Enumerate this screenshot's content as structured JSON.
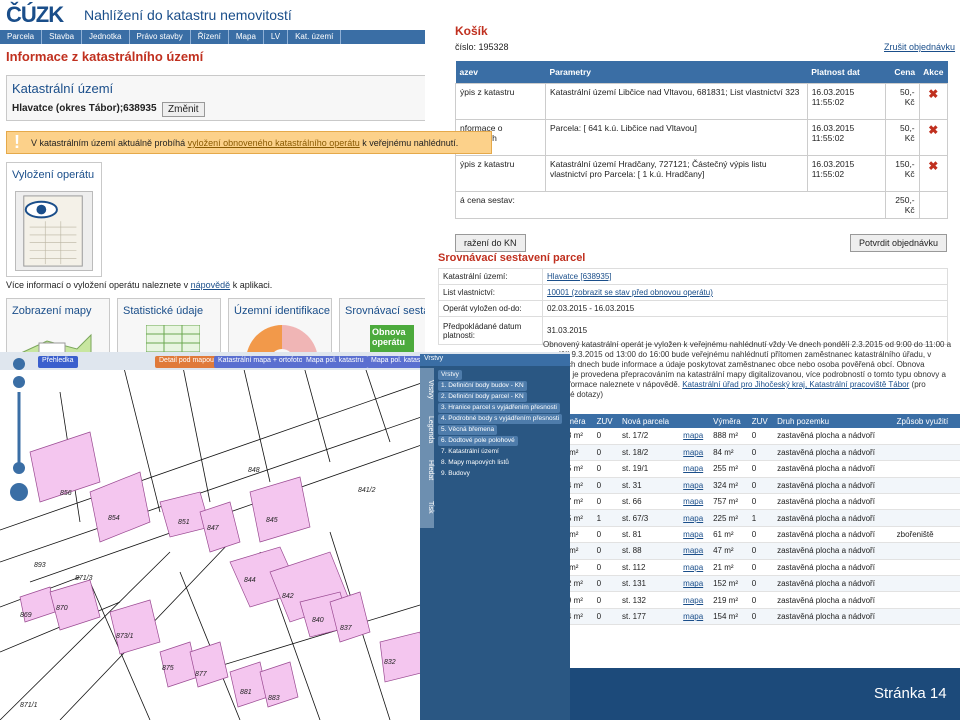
{
  "info_window": {
    "logo": "ČÚZK",
    "app_title": "Nahlížení do katastru nemovitostí",
    "menu": [
      "Parcela",
      "Stavba",
      "Jednotka",
      "Právo stavby",
      "Řízení",
      "Mapa",
      "LV",
      "Kat. území"
    ],
    "heading": "Informace z katastrálního území",
    "box_title": "Katastrální území",
    "box_value": "Hlavatce (okres Tábor);638935",
    "change_button": "Změnit",
    "warning_prefix": "V katastrálním území aktuálně probíhá",
    "warning_link": "vyložení obnoveného katastrálního operátu",
    "warning_suffix": "k veřejnému nahlédnutí.",
    "vylozeni_title": "Vyložení operátu",
    "more_prefix": "Více informací o vyložení operátu naleznete v",
    "more_link": "nápovědě",
    "more_suffix": "k aplikaci.",
    "tiles": [
      "Zobrazení mapy",
      "Statistické údaje",
      "Územní identifikace",
      "Srovnávací sestaven"
    ],
    "tile_badge": "Obnova operátu"
  },
  "cart_window": {
    "title": "Košík",
    "order_no": "číslo: 195328",
    "cancel_link": "Zrušit objednávku",
    "columns": [
      "azev",
      "Parametry",
      "Platnost dat",
      "Cena",
      "Akce"
    ],
    "rows": [
      {
        "name": "ýpis z katastru",
        "params": "Katastrální území Libčice nad Vltavou, 681831; List vlastnictví 323",
        "validity": "16.03.2015 11:55:02",
        "price": "50,- Kč"
      },
      {
        "name": "nformace o parcelách",
        "params": "Parcela: [ 641 k.ú. Libčice nad Vltavou]",
        "validity": "16.03.2015 11:55:02",
        "price": "50,- Kč"
      },
      {
        "name": "ýpis z katastru",
        "params": "Katastrální území Hradčany, 727121; Částečný výpis listu vlastnictví pro Parcela: [ 1 k.ú. Hradčany]",
        "validity": "16.03.2015 11:55:02",
        "price": "150,- Kč"
      }
    ],
    "total_label": "á cena sestav:",
    "total_value": "250,- Kč",
    "back_button": "ražení do KN",
    "confirm_button": "Potvrdit objednávku",
    "section_title": "Srovnávací sestavení parcel",
    "info_rows": [
      {
        "k": "Katastrální území:",
        "v": "Hlavatce [638935]"
      },
      {
        "k": "List vlastnictví:",
        "v": "10001 (zobrazit se stav před obnovou operátu)"
      },
      {
        "k": "Operát vyložen od-do:",
        "v": "02.03.2015 - 16.03.2015"
      },
      {
        "k": "Předpokládané datum platnosti:",
        "v": "31.03.2015"
      }
    ],
    "note": "Obnovený katastrální operát je vyložen k veřejnému nahlédnutí vždy Ve dnech pondělí 2.3.2015 od 9:00 do 11:00 a pondělí 9.3.2015 od 13:00 do 16:00 bude veřejnému nahlédnutí přítomen zaměstnanec katastrálního úřadu, v ostatních dnech bude informace a údaje poskytovat zaměstnanec obce nebo osoba pověřená obcí. Obnova operátu je provedena přepracováním na katastrální mapy digitalizovanou, více podrobností o tomto typu obnovy a další informace naleznete v nápovědě.",
    "note_link": "Katastrální úřad pro Jihočeský kraj, Katastrální pracoviště Tábor",
    "note_link_suffix": "(pro případné dotazy)",
    "parcel_columns": [
      "Výměra",
      "ZUV",
      "Nová parcela",
      "Výměra",
      "ZUV",
      "Druh pozemku",
      "Způsob využití"
    ],
    "parcels": [
      [
        "888 m²",
        "0",
        "st. 17/2",
        "mapa",
        "888 m²",
        "0",
        "zastavěná plocha a nádvoří",
        ""
      ],
      [
        "84 m²",
        "0",
        "st. 18/2",
        "mapa",
        "84 m²",
        "0",
        "zastavěná plocha a nádvoří",
        ""
      ],
      [
        "255 m²",
        "0",
        "st. 19/1",
        "mapa",
        "255 m²",
        "0",
        "zastavěná plocha a nádvoří",
        ""
      ],
      [
        "324 m²",
        "0",
        "st. 31",
        "mapa",
        "324 m²",
        "0",
        "zastavěná plocha a nádvoří",
        ""
      ],
      [
        "757 m²",
        "0",
        "st. 66",
        "mapa",
        "757 m²",
        "0",
        "zastavěná plocha a nádvoří",
        ""
      ],
      [
        "225 m²",
        "1",
        "st. 67/3",
        "mapa",
        "225 m²",
        "1",
        "zastavěná plocha a nádvoří",
        ""
      ],
      [
        "61 m²",
        "0",
        "st. 81",
        "mapa",
        "61 m²",
        "0",
        "zastavěná plocha a nádvoří",
        "zbořeniště"
      ],
      [
        "47 m²",
        "0",
        "st. 88",
        "mapa",
        "47 m²",
        "0",
        "zastavěná plocha a nádvoří",
        ""
      ],
      [
        "21 m²",
        "0",
        "st. 112",
        "mapa",
        "21 m²",
        "0",
        "zastavěná plocha a nádvoří",
        ""
      ],
      [
        "152 m²",
        "0",
        "st. 131",
        "mapa",
        "152 m²",
        "0",
        "zastavěná plocha a nádvoří",
        ""
      ],
      [
        "219 m²",
        "0",
        "st. 132",
        "mapa",
        "219 m²",
        "0",
        "zastavěná plocha a nádvoří",
        ""
      ],
      [
        "154 m²",
        "0",
        "st. 177",
        "mapa",
        "154 m²",
        "0",
        "zastavěná plocha a nádvoří",
        ""
      ]
    ],
    "page_label": "Stránka 14"
  },
  "map_window": {
    "buttons": [
      "Přehledka",
      "Detail pod mapou",
      "Katastrální mapa + ortofoto",
      "Mapa pol. katastru",
      "Mapa pol. katastru +"
    ],
    "layers_title": "Vrstvy",
    "side_tabs": [
      "Vrstvy",
      "Legenda",
      "Hledat",
      "Tisk"
    ],
    "layers": [
      "Vrstvy",
      "1. Definiční body budov - KN",
      "2. Definiční body parcel - KN",
      "3. Hranice parcel s vyjádřením přesnosti",
      "4. Podrobné body s vyjádřením přesnosti",
      "5. Věcná břemena",
      "6. Dodtové pole polohové",
      "7. Katastrální území",
      "8. Mapy mapových listů",
      "9. Budovy"
    ],
    "parcel_labels": [
      "848",
      "856",
      "854",
      "851",
      "847",
      "845",
      "844",
      "842",
      "840",
      "837",
      "841/2",
      "893",
      "869",
      "870",
      "871/3",
      "873/1",
      "875",
      "877",
      "881",
      "883",
      "832",
      "871/1"
    ]
  }
}
